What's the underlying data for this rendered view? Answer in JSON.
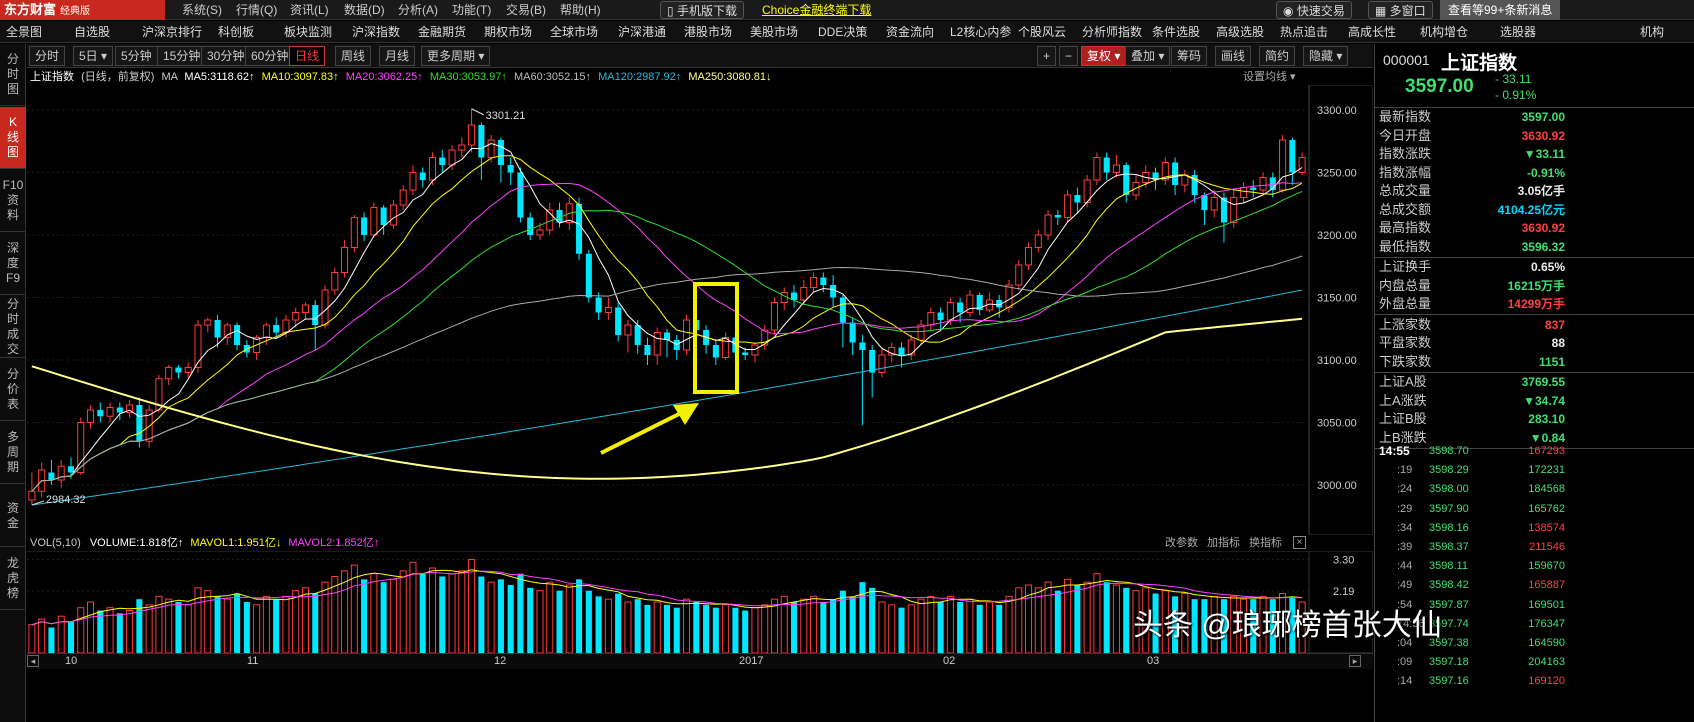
{
  "topbar": {
    "logo": "东方财富",
    "logo_sub": "经典版",
    "menu": [
      "系统(S)",
      "行情(Q)",
      "资讯(L)",
      "数据(D)",
      "分析(A)",
      "功能(T)",
      "交易(B)",
      "帮助(H)"
    ],
    "mobile_btn": "手机版下载",
    "choice_link": "Choice金融终端下载",
    "fast_trade": "快速交易",
    "multi_window": "多窗口",
    "notice": "查看等99+条新消息"
  },
  "navbar": [
    "全景图",
    "自选股",
    "沪深京排行",
    "科创板",
    "板块监测",
    "沪深指数",
    "金融期货",
    "期权市场",
    "全球市场",
    "沪深港通",
    "港股市场",
    "美股市场",
    "DDE决策",
    "资金流向",
    "L2核心内参",
    "个股风云",
    "分析师指数",
    "条件选股",
    "高级选股",
    "热点追击",
    "高成长性",
    "机构增仓",
    "选股器",
    "机构"
  ],
  "sidebar": [
    "分时图",
    "K线图",
    "F10资料",
    "深度F9",
    "分时成交",
    "分价表",
    "多周期",
    "资金",
    "龙虎榜"
  ],
  "toolbar": {
    "periods": [
      "分时",
      "5日",
      "5分钟",
      "15分钟",
      "30分钟",
      "60分钟",
      "日线",
      "周线",
      "月线",
      "更多周期"
    ],
    "right": [
      "+",
      "−",
      "复权",
      "叠加",
      "筹码",
      "画线",
      "简约",
      "隐藏"
    ]
  },
  "chart_info": {
    "name": "上证指数",
    "period_note": "(日线，前复权)",
    "ma_label": "MA",
    "ma5": "MA5:3118.62",
    "ma10": "MA10:3097.83",
    "ma20": "MA20:3062.25",
    "ma30": "MA30:3053.97",
    "ma60": "MA60:3052.15",
    "ma120": "MA120:2987.92",
    "ma250": "MA250:3080.81",
    "settings": "设置均线"
  },
  "volume_info": {
    "vol": "VOL(5,10)",
    "volume": "VOLUME:1.818亿",
    "mavol1": "MAVOL1:1.951亿",
    "mavol2": "MAVOL2:1.852亿",
    "change_params": "改参数",
    "add_indicator": "加指标",
    "switch_indicator": "换指标"
  },
  "chart_data": {
    "type": "candlestick",
    "price_axis": [
      "3300.00",
      "3250.00",
      "3200.00",
      "3150.00",
      "3100.00",
      "3050.00",
      "3000.00"
    ],
    "volume_axis": [
      "3.30",
      "2.19"
    ],
    "time_labels": [
      "10",
      "11",
      "12",
      "2017",
      "02",
      "03"
    ],
    "high_label": "3301.21",
    "low_label": "2984.32",
    "ylim": [
      2960,
      3320
    ],
    "vol_ylim": [
      0,
      3.6
    ],
    "candles": [
      [
        2988,
        2995,
        2984,
        3010
      ],
      [
        2995,
        3012,
        2990,
        3018
      ],
      [
        3010,
        3004,
        3000,
        3020
      ],
      [
        3004,
        3015,
        2998,
        3020
      ],
      [
        3015,
        3010,
        3005,
        3022
      ],
      [
        3010,
        3050,
        3008,
        3054
      ],
      [
        3050,
        3060,
        3045,
        3064
      ],
      [
        3060,
        3055,
        3050,
        3066
      ],
      [
        3055,
        3062,
        3050,
        3066
      ],
      [
        3062,
        3058,
        3052,
        3066
      ],
      [
        3058,
        3064,
        3054,
        3068
      ],
      [
        3064,
        3035,
        3030,
        3070
      ],
      [
        3035,
        3060,
        3030,
        3064
      ],
      [
        3060,
        3085,
        3058,
        3088
      ],
      [
        3085,
        3094,
        3080,
        3096
      ],
      [
        3094,
        3090,
        3085,
        3096
      ],
      [
        3090,
        3094,
        3085,
        3098
      ],
      [
        3094,
        3128,
        3090,
        3132
      ],
      [
        3128,
        3132,
        3122,
        3134
      ],
      [
        3132,
        3118,
        3110,
        3136
      ],
      [
        3118,
        3128,
        3112,
        3130
      ],
      [
        3128,
        3112,
        3108,
        3130
      ],
      [
        3112,
        3106,
        3102,
        3116
      ],
      [
        3106,
        3118,
        3100,
        3120
      ],
      [
        3118,
        3128,
        3112,
        3130
      ],
      [
        3128,
        3122,
        3118,
        3134
      ],
      [
        3122,
        3132,
        3118,
        3136
      ],
      [
        3132,
        3138,
        3126,
        3142
      ],
      [
        3138,
        3144,
        3132,
        3146
      ],
      [
        3144,
        3128,
        3108,
        3148
      ],
      [
        3128,
        3156,
        3125,
        3160
      ],
      [
        3156,
        3170,
        3152,
        3174
      ],
      [
        3170,
        3190,
        3166,
        3196
      ],
      [
        3190,
        3214,
        3186,
        3216
      ],
      [
        3214,
        3200,
        3195,
        3218
      ],
      [
        3200,
        3222,
        3198,
        3226
      ],
      [
        3222,
        3208,
        3200,
        3224
      ],
      [
        3208,
        3224,
        3205,
        3228
      ],
      [
        3224,
        3236,
        3220,
        3240
      ],
      [
        3236,
        3250,
        3232,
        3256
      ],
      [
        3250,
        3244,
        3238,
        3254
      ],
      [
        3244,
        3262,
        3240,
        3266
      ],
      [
        3262,
        3256,
        3250,
        3268
      ],
      [
        3256,
        3268,
        3252,
        3272
      ],
      [
        3268,
        3272,
        3262,
        3278
      ],
      [
        3272,
        3288,
        3266,
        3301
      ],
      [
        3288,
        3262,
        3244,
        3290
      ],
      [
        3262,
        3276,
        3258,
        3280
      ],
      [
        3276,
        3256,
        3242,
        3278
      ],
      [
        3256,
        3250,
        3240,
        3262
      ],
      [
        3250,
        3214,
        3210,
        3254
      ],
      [
        3214,
        3200,
        3196,
        3218
      ],
      [
        3200,
        3204,
        3196,
        3210
      ],
      [
        3204,
        3220,
        3200,
        3226
      ],
      [
        3220,
        3210,
        3206,
        3226
      ],
      [
        3210,
        3225,
        3204,
        3230
      ],
      [
        3225,
        3185,
        3180,
        3230
      ],
      [
        3185,
        3150,
        3146,
        3188
      ],
      [
        3150,
        3138,
        3132,
        3154
      ],
      [
        3138,
        3142,
        3132,
        3150
      ],
      [
        3142,
        3120,
        3115,
        3146
      ],
      [
        3120,
        3128,
        3106,
        3132
      ],
      [
        3128,
        3112,
        3105,
        3132
      ],
      [
        3112,
        3104,
        3096,
        3118
      ],
      [
        3104,
        3122,
        3096,
        3126
      ],
      [
        3122,
        3116,
        3102,
        3125
      ],
      [
        3116,
        3108,
        3100,
        3120
      ],
      [
        3108,
        3132,
        3104,
        3136
      ],
      [
        3132,
        3124,
        3116,
        3136
      ],
      [
        3124,
        3112,
        3105,
        3128
      ],
      [
        3112,
        3102,
        3096,
        3116
      ],
      [
        3102,
        3118,
        3100,
        3122
      ],
      [
        3118,
        3106,
        3102,
        3122
      ],
      [
        3106,
        3104,
        3100,
        3110
      ],
      [
        3104,
        3112,
        3098,
        3114
      ],
      [
        3112,
        3124,
        3108,
        3128
      ],
      [
        3124,
        3146,
        3120,
        3150
      ],
      [
        3146,
        3154,
        3140,
        3158
      ],
      [
        3154,
        3148,
        3142,
        3160
      ],
      [
        3148,
        3158,
        3144,
        3164
      ],
      [
        3158,
        3166,
        3154,
        3170
      ],
      [
        3166,
        3160,
        3154,
        3170
      ],
      [
        3160,
        3150,
        3142,
        3168
      ],
      [
        3150,
        3130,
        3110,
        3152
      ],
      [
        3130,
        3114,
        3104,
        3134
      ],
      [
        3114,
        3108,
        3048,
        3120
      ],
      [
        3108,
        3090,
        3070,
        3112
      ],
      [
        3090,
        3104,
        3086,
        3110
      ],
      [
        3104,
        3110,
        3098,
        3114
      ],
      [
        3110,
        3104,
        3094,
        3114
      ],
      [
        3104,
        3116,
        3100,
        3120
      ],
      [
        3116,
        3128,
        3112,
        3132
      ],
      [
        3128,
        3138,
        3124,
        3142
      ],
      [
        3138,
        3132,
        3124,
        3142
      ],
      [
        3132,
        3146,
        3128,
        3150
      ],
      [
        3146,
        3138,
        3130,
        3150
      ],
      [
        3138,
        3152,
        3134,
        3156
      ],
      [
        3152,
        3140,
        3136,
        3154
      ],
      [
        3140,
        3148,
        3138,
        3154
      ],
      [
        3148,
        3142,
        3134,
        3152
      ],
      [
        3142,
        3160,
        3138,
        3164
      ],
      [
        3160,
        3176,
        3156,
        3180
      ],
      [
        3176,
        3190,
        3172,
        3194
      ],
      [
        3190,
        3200,
        3186,
        3204
      ],
      [
        3200,
        3216,
        3196,
        3220
      ],
      [
        3216,
        3214,
        3208,
        3220
      ],
      [
        3214,
        3232,
        3210,
        3236
      ],
      [
        3232,
        3226,
        3218,
        3238
      ],
      [
        3226,
        3244,
        3222,
        3248
      ],
      [
        3244,
        3262,
        3240,
        3266
      ],
      [
        3262,
        3250,
        3244,
        3266
      ],
      [
        3250,
        3256,
        3246,
        3264
      ],
      [
        3256,
        3232,
        3226,
        3258
      ],
      [
        3232,
        3242,
        3228,
        3248
      ],
      [
        3242,
        3250,
        3238,
        3256
      ],
      [
        3250,
        3244,
        3236,
        3254
      ],
      [
        3244,
        3258,
        3240,
        3262
      ],
      [
        3258,
        3240,
        3232,
        3262
      ],
      [
        3240,
        3248,
        3234,
        3252
      ],
      [
        3248,
        3232,
        3226,
        3252
      ],
      [
        3232,
        3220,
        3208,
        3234
      ],
      [
        3220,
        3230,
        3214,
        3236
      ],
      [
        3230,
        3210,
        3194,
        3234
      ],
      [
        3210,
        3230,
        3206,
        3236
      ],
      [
        3230,
        3238,
        3226,
        3242
      ],
      [
        3238,
        3236,
        3230,
        3244
      ],
      [
        3236,
        3246,
        3232,
        3250
      ],
      [
        3246,
        3236,
        3230,
        3250
      ],
      [
        3236,
        3276,
        3234,
        3280
      ],
      [
        3276,
        3250,
        3240,
        3278
      ],
      [
        3250,
        3262,
        3248,
        3266
      ]
    ],
    "volumes": [
      1.0,
      1.2,
      0.9,
      1.3,
      1.1,
      1.6,
      1.8,
      1.5,
      1.6,
      1.4,
      1.5,
      1.9,
      1.7,
      2.0,
      1.9,
      1.8,
      1.7,
      2.3,
      2.2,
      2.0,
      1.9,
      2.1,
      1.8,
      1.7,
      2.0,
      1.9,
      2.0,
      2.2,
      2.3,
      2.1,
      2.5,
      2.7,
      2.9,
      3.1,
      2.6,
      2.8,
      2.5,
      2.6,
      2.9,
      3.2,
      2.8,
      3.0,
      2.7,
      2.8,
      2.9,
      3.3,
      2.7,
      2.5,
      2.6,
      2.4,
      2.8,
      2.3,
      2.2,
      2.5,
      2.2,
      2.4,
      2.6,
      2.2,
      2.0,
      1.9,
      2.1,
      1.8,
      1.9,
      1.7,
      1.8,
      1.7,
      1.6,
      1.9,
      1.8,
      1.7,
      1.6,
      1.7,
      1.6,
      1.5,
      1.6,
      1.7,
      1.9,
      2.0,
      1.8,
      1.9,
      2.0,
      1.8,
      1.9,
      2.2,
      2.0,
      2.5,
      2.3,
      1.8,
      1.7,
      1.6,
      1.7,
      1.9,
      2.0,
      1.8,
      2.0,
      1.8,
      1.9,
      1.7,
      1.8,
      1.7,
      2.0,
      2.3,
      2.4,
      2.3,
      2.5,
      2.2,
      2.6,
      2.4,
      2.5,
      2.8,
      2.5,
      2.4,
      2.3,
      2.2,
      2.3,
      2.1,
      2.2,
      2.0,
      2.1,
      1.9,
      1.9,
      2.0,
      1.9,
      2.0,
      1.9,
      1.9,
      2.0,
      1.9,
      2.1,
      2.0,
      1.8
    ]
  },
  "right_panel": {
    "code": "000001",
    "name": "上证指数",
    "price": "3597.00",
    "change": "- 33.11",
    "change_pct": "- 0.91%",
    "rows1": [
      {
        "label": "最新指数",
        "value": "3597.00",
        "color": "green"
      },
      {
        "label": "今日开盘",
        "value": "3630.92",
        "color": "red"
      },
      {
        "label": "指数涨跌",
        "value": "▼33.11",
        "color": "green"
      },
      {
        "label": "指数涨幅",
        "value": "-0.91%",
        "color": "green"
      },
      {
        "label": "总成交量",
        "value": "3.05亿手",
        "color": "white"
      },
      {
        "label": "总成交额",
        "value": "4104.25亿元",
        "color": "cyan"
      },
      {
        "label": "最高指数",
        "value": "3630.92",
        "color": "red"
      },
      {
        "label": "最低指数",
        "value": "3596.32",
        "color": "green"
      }
    ],
    "rows2": [
      {
        "label": "上证换手",
        "value": "0.65%",
        "color": "white"
      },
      {
        "label": "内盘总量",
        "value": "16215万手",
        "color": "green"
      },
      {
        "label": "外盘总量",
        "value": "14299万手",
        "color": "red"
      }
    ],
    "rows3": [
      {
        "label": "上涨家数",
        "value": "837",
        "color": "red"
      },
      {
        "label": "平盘家数",
        "value": "88",
        "color": "white"
      },
      {
        "label": "下跌家数",
        "value": "1151",
        "color": "green"
      }
    ],
    "rows4": [
      {
        "label": "上证A股",
        "value": "3769.55",
        "color": "green"
      },
      {
        "label": "上A涨跌",
        "value": "▼34.74",
        "color": "green"
      },
      {
        "label": "上证B股",
        "value": "283.10",
        "color": "green"
      },
      {
        "label": "上B涨跌",
        "value": "▼0.84",
        "color": "green"
      }
    ],
    "ticks": [
      {
        "time": "14:55",
        "price": "3598.70",
        "vol": "167293",
        "vcolor": "red"
      },
      {
        "time": ":19",
        "price": "3598.29",
        "vol": "172231",
        "vcolor": "green"
      },
      {
        "time": ":24",
        "price": "3598.00",
        "vol": "184568",
        "vcolor": "green"
      },
      {
        "time": ":29",
        "price": "3597.90",
        "vol": "165762",
        "vcolor": "green"
      },
      {
        "time": ":34",
        "price": "3598.16",
        "vol": "138574",
        "vcolor": "red"
      },
      {
        "time": ":39",
        "price": "3598.37",
        "vol": "211546",
        "vcolor": "red"
      },
      {
        "time": ":44",
        "price": "3598.11",
        "vol": "159670",
        "vcolor": "green"
      },
      {
        "time": ":49",
        "price": "3598.42",
        "vol": "165887",
        "vcolor": "red"
      },
      {
        "time": ":54",
        "price": "3597.87",
        "vol": "169501",
        "vcolor": "green"
      },
      {
        "time": "14:56",
        "price": "3597.74",
        "vol": "176347",
        "vcolor": "green"
      },
      {
        "time": ":04",
        "price": "3597.38",
        "vol": "164590",
        "vcolor": "green"
      },
      {
        "time": ":09",
        "price": "3597.18",
        "vol": "204163",
        "vcolor": "green"
      },
      {
        "time": ":14",
        "price": "3597.16",
        "vol": "169120",
        "vcolor": "red"
      }
    ]
  },
  "watermark": "头条 @琅琊榜首张大仙",
  "colors": {
    "up": "#ff3b3b",
    "down": "#00e6ff",
    "ma5": "#ffffff",
    "ma10": "#ffff00",
    "ma20": "#ff40ff",
    "ma30": "#33dd33",
    "ma60": "#aaaaaa",
    "ma120": "#22bbdd",
    "ma250": "#ffff88",
    "highlight": "#f2f200"
  }
}
